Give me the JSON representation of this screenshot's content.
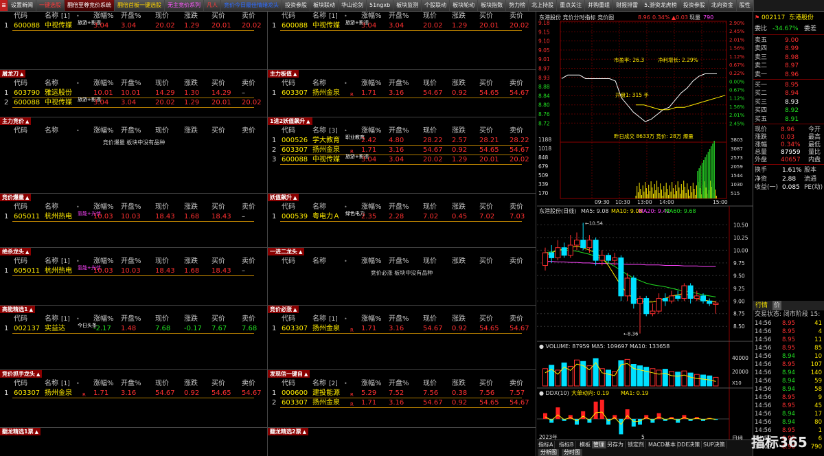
{
  "tabs": [
    {
      "label": "设置新闻",
      "color": "white"
    },
    {
      "label": "一键选股",
      "color": "red"
    },
    {
      "label": "翻倍至尊竞价系统",
      "color": "white",
      "active": true
    },
    {
      "label": "翻倍首板一键选股",
      "color": "yellow"
    },
    {
      "label": "无主竞价系列",
      "color": "pink"
    },
    {
      "label": "凡人",
      "color": "red"
    },
    {
      "label": "竞价今日最佳情绪龙头",
      "color": "blue"
    },
    {
      "label": "投资参股",
      "color": "white"
    },
    {
      "label": "板块联动",
      "color": "white"
    },
    {
      "label": "华山论剑",
      "color": "white"
    },
    {
      "label": "51ngxb",
      "color": "white"
    },
    {
      "label": "板块监测",
      "color": "white"
    },
    {
      "label": "个股联动",
      "color": "white"
    },
    {
      "label": "板块轮动",
      "color": "white"
    },
    {
      "label": "板块指数",
      "color": "white"
    },
    {
      "label": "势力榜",
      "color": "white"
    },
    {
      "label": "北上持股",
      "color": "white"
    },
    {
      "label": "重点关注",
      "color": "white"
    },
    {
      "label": "并购重组",
      "color": "white"
    },
    {
      "label": "财报排雷",
      "color": "white"
    },
    {
      "label": "5.游资龙虎榜",
      "color": "white"
    },
    {
      "label": "投资参股",
      "color": "white"
    },
    {
      "label": "北向资金",
      "color": "white"
    },
    {
      "label": "股性",
      "color": "white"
    }
  ],
  "headers": {
    "code": "代码",
    "name": "名称",
    "chg": "涨幅%",
    "open": "开盘%",
    "price": "现价",
    "diff": "涨跌",
    "bid": "买价",
    "ask": "卖价",
    "dot": "•"
  },
  "panels": [
    {
      "title": "",
      "count": "[1]",
      "rows": [
        {
          "idx": "1",
          "code": "600088",
          "name": "中视传媒",
          "tag": "旅游+影视",
          "mk": "",
          "chg": "3.04",
          "open": "3.04",
          "price": "20.02",
          "diff": "1.29",
          "bid": "20.01",
          "ask": "20.02",
          "dir": "up"
        }
      ]
    },
    {
      "title": "",
      "count": "[1]",
      "rows": [
        {
          "idx": "1",
          "code": "600088",
          "name": "中视传媒",
          "tag": "旅游+影视",
          "mk": "",
          "chg": "3.04",
          "open": "3.04",
          "price": "20.02",
          "diff": "1.29",
          "bid": "20.01",
          "ask": "20.02",
          "dir": "up"
        }
      ]
    },
    {
      "title": "屠龙刀",
      "count": "",
      "rows": [
        {
          "idx": "1",
          "code": "603790",
          "name": "雅运股份",
          "tag": "",
          "mk": "",
          "chg": "10.01",
          "open": "10.01",
          "price": "14.29",
          "diff": "1.30",
          "bid": "14.29",
          "ask": "–",
          "dir": "up"
        },
        {
          "idx": "2",
          "code": "600088",
          "name": "中视传媒",
          "tag": "旅游+影视",
          "mk": "",
          "chg": "3.04",
          "open": "3.04",
          "price": "20.02",
          "diff": "1.29",
          "bid": "20.01",
          "ask": "20.02",
          "dir": "up"
        }
      ]
    },
    {
      "title": "主力板值",
      "count": "",
      "rows": [
        {
          "idx": "1",
          "code": "603307",
          "name": "扬州金泉",
          "tag": "",
          "mk": "R",
          "chg": "1.71",
          "open": "3.16",
          "price": "54.67",
          "diff": "0.92",
          "bid": "54.65",
          "ask": "54.67",
          "dir": "up"
        }
      ]
    },
    {
      "title": "主力竞价",
      "count": "",
      "rows": [],
      "empty": "竞价爆量 板块中没有品种"
    },
    {
      "title": "1进2妖值飙升",
      "count": "[3]",
      "rows": [
        {
          "idx": "1",
          "code": "000526",
          "name": "学大教育",
          "tag": "职业教育",
          "mk": "",
          "chg": "2.42",
          "open": "4.80",
          "price": "28.22",
          "diff": "2.57",
          "bid": "28.21",
          "ask": "28.22",
          "dir": "up"
        },
        {
          "idx": "2",
          "code": "603307",
          "name": "扬州金泉",
          "tag": "",
          "mk": "R",
          "chg": "1.71",
          "open": "3.16",
          "price": "54.67",
          "diff": "0.92",
          "bid": "54.65",
          "ask": "54.67",
          "dir": "up"
        },
        {
          "idx": "3",
          "code": "600088",
          "name": "中视传媒",
          "tag": "旅游+影视",
          "mk": "",
          "chg": "3.04",
          "open": "3.04",
          "price": "20.02",
          "diff": "1.29",
          "bid": "20.01",
          "ask": "20.02",
          "dir": "up"
        }
      ]
    },
    {
      "title": "竞价爆量",
      "count": "",
      "rows": [
        {
          "idx": "1",
          "code": "605011",
          "name": "杭州热电",
          "tag": "氢能+光伏",
          "mk": "",
          "chg": "10.03",
          "open": "10.03",
          "price": "18.43",
          "diff": "1.68",
          "bid": "18.43",
          "ask": "–",
          "dir": "up",
          "pinktag": true
        }
      ]
    },
    {
      "title": "妖值飙升",
      "count": "",
      "rows": [
        {
          "idx": "1",
          "code": "000539",
          "name": "粤电力Ａ",
          "tag": "绿色电力",
          "mk": "",
          "chg": "2.35",
          "open": "2.28",
          "price": "7.02",
          "diff": "0.45",
          "bid": "7.02",
          "ask": "7.03",
          "dir": "up"
        }
      ]
    },
    {
      "title": "绝杀龙头",
      "count": "[1]",
      "rows": [
        {
          "idx": "1",
          "code": "605011",
          "name": "杭州热电",
          "tag": "氢能+光伏",
          "mk": "",
          "chg": "10.03",
          "open": "10.03",
          "price": "18.43",
          "diff": "1.68",
          "bid": "18.43",
          "ask": "–",
          "dir": "up",
          "pinktag": true
        }
      ]
    },
    {
      "title": "一进二龙头",
      "count": "",
      "rows": [],
      "empty": "竞价必涨 板块中没有品种"
    },
    {
      "title": "高能精选1",
      "count": "[1]",
      "rows": [
        {
          "idx": "1",
          "code": "002137",
          "name": "实益达",
          "tag": "今日头条",
          "mk": "",
          "chg": "-2.17",
          "open": "1.48",
          "price": "7.68",
          "diff": "-0.17",
          "bid": "7.67",
          "ask": "7.68",
          "dir": "dn"
        }
      ]
    },
    {
      "title": "竞价必涨",
      "count": "[1]",
      "rows": [
        {
          "idx": "1",
          "code": "603307",
          "name": "扬州金泉",
          "tag": "",
          "mk": "R",
          "chg": "1.71",
          "open": "3.16",
          "price": "54.67",
          "diff": "0.92",
          "bid": "54.65",
          "ask": "54.67",
          "dir": "up"
        }
      ]
    },
    {
      "title": "竞价抓手龙头",
      "count": "[1]",
      "rows": [
        {
          "idx": "1",
          "code": "603307",
          "name": "扬州金泉",
          "tag": "",
          "mk": "R",
          "chg": "1.71",
          "open": "3.16",
          "price": "54.67",
          "diff": "0.92",
          "bid": "54.65",
          "ask": "54.67",
          "dir": "up"
        }
      ]
    },
    {
      "title": "发现信一键自",
      "count": "[2]",
      "rows": [
        {
          "idx": "1",
          "code": "000600",
          "name": "建投能源",
          "tag": "",
          "mk": "R",
          "chg": "5.29",
          "open": "7.52",
          "price": "7.56",
          "diff": "0.38",
          "bid": "7.56",
          "ask": "7.57",
          "dir": "up"
        },
        {
          "idx": "2",
          "code": "603307",
          "name": "扬州金泉",
          "tag": "",
          "mk": "R",
          "chg": "1.71",
          "open": "3.16",
          "price": "54.67",
          "diff": "0.92",
          "bid": "54.65",
          "ask": "54.67",
          "dir": "up"
        }
      ]
    },
    {
      "title": "翻龙精选1票",
      "count": "",
      "rows": []
    },
    {
      "title": "翻龙精选2票",
      "count": "",
      "rows": []
    }
  ],
  "intraday": {
    "title": "东港股份  竞价分时指标 竞价图",
    "price": "8.96",
    "pct": "0.34%",
    "delta": "▲0.03",
    "mode": "现量",
    "vol": "790",
    "pe_label": "市盈率: 26.3",
    "growth_label": "净利增长: 2.29%",
    "open_vol": "开盘1: 315 手",
    "auction_info": "昨日成交  8633万  竞价: 28万  爆量",
    "left_ticks": [
      "9.18",
      "9.15",
      "9.10",
      "9.05",
      "9.01",
      "8.97",
      "8.93",
      "8.88",
      "8.84",
      "8.80",
      "8.76",
      "8.72"
    ],
    "right_ticks": [
      "2.90%",
      "2.45%",
      "2.01%",
      "1.56%",
      "1.12%",
      "0.67%",
      "0.22%",
      "0.00%",
      "0.67%",
      "1.12%",
      "1.56%",
      "2.01%",
      "2.45%"
    ],
    "vol_ticks": [
      "1188",
      "1018",
      "848",
      "679",
      "509",
      "339",
      "170"
    ],
    "vol_right": [
      "3803",
      "3087",
      "2573",
      "2059",
      "1544",
      "1030",
      "515"
    ],
    "time_ticks": [
      "09:30",
      "10:30",
      "13:00",
      "14:00",
      "15:00"
    ],
    "price_line": [
      8.94,
      8.955,
      8.955,
      8.955,
      8.94,
      8.94,
      8.94,
      8.94,
      8.94,
      8.93,
      8.86,
      8.83,
      8.8,
      8.78,
      8.76,
      8.77,
      8.79,
      8.81,
      8.82,
      8.85,
      8.88,
      8.9,
      8.93,
      8.95,
      8.96,
      8.96,
      8.96
    ],
    "avg_line": [
      8.83,
      8.83,
      8.82,
      8.81,
      8.81,
      8.82,
      8.82,
      8.83,
      8.84,
      8.85,
      8.86,
      8.87
    ]
  },
  "kline": {
    "title": "东港股份(日线)",
    "ma5": "MA5: 9.08",
    "ma10": "MA10: 9.08",
    "ma20": "MA20: 9.42",
    "ma60": "MA60: 9.68",
    "high_label": "10.54",
    "low_label": "8.36",
    "ticks": [
      "10.50",
      "10.25",
      "10.00",
      "9.75",
      "9.50",
      "9.25",
      "9.00",
      "8.75",
      "8.50"
    ],
    "candles": [
      {
        "o": 9.7,
        "c": 9.95,
        "h": 10.05,
        "l": 9.6
      },
      {
        "o": 9.95,
        "c": 9.85,
        "h": 10.1,
        "l": 9.75
      },
      {
        "o": 9.85,
        "c": 10.05,
        "h": 10.2,
        "l": 9.8
      },
      {
        "o": 10.05,
        "c": 9.9,
        "h": 10.15,
        "l": 9.85
      },
      {
        "o": 9.9,
        "c": 10.1,
        "h": 10.3,
        "l": 9.85
      },
      {
        "o": 10.1,
        "c": 10.2,
        "h": 10.35,
        "l": 10.0
      },
      {
        "o": 10.2,
        "c": 10.05,
        "h": 10.54,
        "l": 10.0
      },
      {
        "o": 10.05,
        "c": 10.2,
        "h": 10.3,
        "l": 9.95
      },
      {
        "o": 10.2,
        "c": 9.8,
        "h": 10.25,
        "l": 9.7
      },
      {
        "o": 9.8,
        "c": 9.9,
        "h": 10.0,
        "l": 9.7
      },
      {
        "o": 9.9,
        "c": 9.8,
        "h": 9.95,
        "l": 9.75
      },
      {
        "o": 9.8,
        "c": 9.85,
        "h": 9.95,
        "l": 9.7
      },
      {
        "o": 9.85,
        "c": 9.1,
        "h": 9.9,
        "l": 9.0
      },
      {
        "o": 9.1,
        "c": 9.45,
        "h": 9.55,
        "l": 9.0
      },
      {
        "o": 9.45,
        "c": 8.95,
        "h": 9.5,
        "l": 8.85
      },
      {
        "o": 8.95,
        "c": 9.05,
        "h": 9.1,
        "l": 8.36
      },
      {
        "o": 9.05,
        "c": 8.75,
        "h": 9.1,
        "l": 8.7
      },
      {
        "o": 8.75,
        "c": 8.8,
        "h": 8.95,
        "l": 8.7
      },
      {
        "o": 8.8,
        "c": 9.05,
        "h": 9.15,
        "l": 8.75
      },
      {
        "o": 9.05,
        "c": 9.0,
        "h": 9.15,
        "l": 8.9
      },
      {
        "o": 9.0,
        "c": 9.1,
        "h": 9.2,
        "l": 8.95
      },
      {
        "o": 9.1,
        "c": 9.05,
        "h": 9.2,
        "l": 9.0
      },
      {
        "o": 9.05,
        "c": 9.3,
        "h": 9.35,
        "l": 9.0
      },
      {
        "o": 9.3,
        "c": 9.05,
        "h": 9.35,
        "l": 8.95
      },
      {
        "o": 9.05,
        "c": 9.1,
        "h": 9.2,
        "l": 9.0
      },
      {
        "o": 9.1,
        "c": 9.0,
        "h": 9.15,
        "l": 8.95
      },
      {
        "o": 9.0,
        "c": 8.95,
        "h": 9.05,
        "l": 8.9
      },
      {
        "o": 8.93,
        "c": 8.96,
        "h": 9.0,
        "l": 8.75
      }
    ],
    "ma5_line": [
      9.9,
      9.95,
      10.0,
      10.02,
      10.05,
      10.08,
      10.05,
      10.0,
      9.95,
      9.85,
      9.7,
      9.5,
      9.3,
      9.15,
      9.05,
      9.0,
      8.98,
      8.98,
      9.0,
      9.05,
      9.1,
      9.12,
      9.15,
      9.1,
      9.05,
      9.02,
      9.0,
      8.98
    ],
    "ma20_line": [
      9.95,
      9.97,
      10.0,
      10.0,
      10.0,
      9.98,
      9.95,
      9.92,
      9.88,
      9.82,
      9.75,
      9.68,
      9.6,
      9.52,
      9.45,
      9.4,
      9.35,
      9.32,
      9.3,
      9.28,
      9.25,
      9.22,
      9.2,
      9.18,
      9.15,
      9.12,
      9.1,
      9.08
    ],
    "ma60_line": [
      9.78,
      9.78,
      9.77,
      9.77,
      9.76,
      9.76,
      9.75,
      9.75,
      9.74,
      9.74,
      9.74,
      9.73,
      9.73,
      9.72,
      9.72,
      9.72,
      9.71,
      9.71,
      9.71,
      9.7,
      9.7,
      9.7,
      9.69,
      9.69,
      9.69,
      9.68,
      9.68,
      9.68
    ]
  },
  "volume": {
    "title": "VOLUME: 87959  MA5: 109697  MA10: 133658",
    "ticks": [
      "40000",
      "20000"
    ],
    "unit": "X10",
    "bars": [
      60,
      72,
      55,
      80,
      68,
      90,
      85,
      70,
      95,
      60,
      55,
      50,
      88,
      92,
      75,
      70,
      65,
      60,
      55,
      58,
      50,
      48,
      52,
      45,
      40,
      38,
      35,
      30
    ],
    "dirs": [
      "up",
      "dn",
      "up",
      "dn",
      "up",
      "up",
      "dn",
      "up",
      "dn",
      "up",
      "dn",
      "up",
      "dn",
      "up",
      "dn",
      "dn",
      "dn",
      "up",
      "up",
      "dn",
      "up",
      "dn",
      "up",
      "dn",
      "up",
      "dn",
      "dn",
      "up"
    ]
  },
  "ddx": {
    "title": "DDX(10)",
    "label": "大单动向: 0.19",
    "ma1": "MA1: 0.19",
    "month_label": "2023年",
    "month5": "5",
    "bars": [
      0.3,
      -0.2,
      0.6,
      -0.1,
      0.2,
      -0.3,
      0.4,
      -0.2,
      0.9,
      1.0,
      -0.3,
      0.2,
      -0.8,
      0.5,
      -0.4,
      -0.3,
      0.2,
      -0.2,
      0.3,
      -0.1,
      0.1,
      -0.2,
      0.2,
      -0.1,
      0.1,
      -0.1,
      0.05,
      -0.05
    ]
  },
  "bottom_tabs": [
    "指标A",
    "指标B",
    "模板",
    "管理",
    "另存为",
    "锁定剂",
    "MACD基本",
    "DDE决策",
    "SUP决策"
  ],
  "bottom_btns": [
    "分析图",
    "分时图"
  ],
  "day_label": "日线",
  "quote": {
    "code": "002117",
    "name": "东港股份",
    "webi_label": "委比",
    "webi": "-34.67%",
    "weicha_label": "委差",
    "weicha": "",
    "asks": [
      {
        "l": "卖五",
        "p": "9.00"
      },
      {
        "l": "卖四",
        "p": "8.99"
      },
      {
        "l": "卖三",
        "p": "8.98"
      },
      {
        "l": "卖二",
        "p": "8.97"
      },
      {
        "l": "卖一",
        "p": "8.96"
      }
    ],
    "bids": [
      {
        "l": "买一",
        "p": "8.95"
      },
      {
        "l": "买二",
        "p": "8.94"
      },
      {
        "l": "买三",
        "p": "8.93"
      },
      {
        "l": "买四",
        "p": "8.92"
      },
      {
        "l": "买五",
        "p": "8.91"
      }
    ],
    "stats": [
      {
        "l": "现价",
        "v": "8.96",
        "r": "今开",
        "c": "up"
      },
      {
        "l": "涨跌",
        "v": "0.03",
        "r": "最高",
        "c": "up"
      },
      {
        "l": "涨幅",
        "v": "0.34%",
        "r": "最低",
        "c": "up"
      },
      {
        "l": "总量",
        "v": "87959",
        "r": "量比",
        "c": "w"
      },
      {
        "l": "外盘",
        "v": "40657",
        "r": "内盘",
        "c": "up"
      }
    ],
    "stats2": [
      {
        "l": "换手",
        "v": "1.61%",
        "r": "股本"
      },
      {
        "l": "净资",
        "v": "2.88",
        "r": "流通"
      },
      {
        "l": "收益(一)",
        "v": "0.085",
        "r": "PE(动)"
      }
    ],
    "trade_tab": "行情",
    "trade_tab2": "价",
    "state": "交易状态: 闭市阶段 15:",
    "trades": [
      {
        "t": "14:56",
        "p": "8.95",
        "v": "41",
        "c": "up"
      },
      {
        "t": "14:56",
        "p": "8.95",
        "v": "4",
        "c": "up"
      },
      {
        "t": "14:56",
        "p": "8.95",
        "v": "11",
        "c": "up"
      },
      {
        "t": "14:56",
        "p": "8.95",
        "v": "85",
        "c": "up"
      },
      {
        "t": "14:56",
        "p": "8.94",
        "v": "10",
        "c": "dn"
      },
      {
        "t": "14:56",
        "p": "8.95",
        "v": "107",
        "c": "up"
      },
      {
        "t": "14:56",
        "p": "8.94",
        "v": "140",
        "c": "dn"
      },
      {
        "t": "14:56",
        "p": "8.94",
        "v": "59",
        "c": "dn"
      },
      {
        "t": "14:56",
        "p": "8.94",
        "v": "58",
        "c": "dn"
      },
      {
        "t": "14:56",
        "p": "8.95",
        "v": "9",
        "c": "up"
      },
      {
        "t": "14:56",
        "p": "8.95",
        "v": "45",
        "c": "up"
      },
      {
        "t": "14:56",
        "p": "8.94",
        "v": "17",
        "c": "dn"
      },
      {
        "t": "14:56",
        "p": "8.94",
        "v": "80",
        "c": "dn"
      },
      {
        "t": "14:56",
        "p": "8.95",
        "v": "1",
        "c": "up"
      },
      {
        "t": "14:57",
        "p": "8.95",
        "v": "6",
        "c": "up"
      },
      {
        "t": "15:00",
        "p": "8.96",
        "v": "790",
        "c": "up"
      }
    ]
  },
  "watermark": "指标365"
}
